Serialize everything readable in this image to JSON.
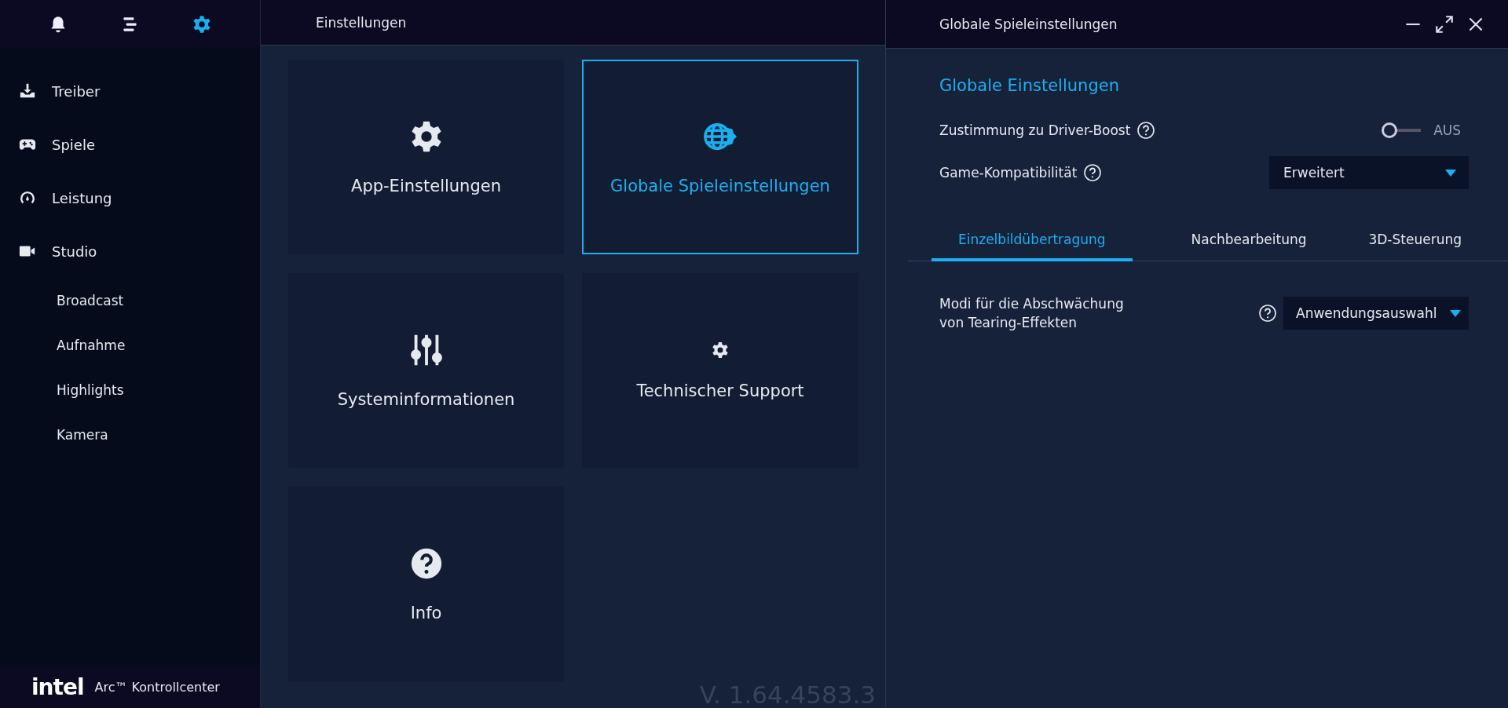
{
  "sidebar": {
    "top_icons": [
      {
        "kind": "bell",
        "selected": false
      },
      {
        "kind": "menu",
        "selected": false
      },
      {
        "kind": "gear",
        "selected": true
      }
    ],
    "items": [
      {
        "label": "Treiber",
        "kind": "download"
      },
      {
        "label": "Spiele",
        "kind": "gamepad"
      },
      {
        "label": "Leistung",
        "kind": "gauge"
      },
      {
        "label": "Studio",
        "kind": "camera",
        "children": [
          {
            "label": "Broadcast"
          },
          {
            "label": "Aufnahme"
          },
          {
            "label": "Highlights"
          },
          {
            "label": "Kamera"
          }
        ]
      }
    ],
    "footer": {
      "logo": "intel",
      "product": "Arc™ Kontrollcenter"
    }
  },
  "settings": {
    "title": "Einstellungen",
    "cards": [
      {
        "label": "App-Einstellungen",
        "kind": "gear",
        "selected": false
      },
      {
        "label": "Globale Spieleinstellungen",
        "kind": "globe-gear",
        "selected": true
      },
      {
        "label": "Systeminformationen",
        "kind": "sliders",
        "selected": false
      },
      {
        "label": "Technischer Support",
        "kind": "small-gear",
        "selected": false
      },
      {
        "label": "Info",
        "kind": "help",
        "selected": false
      }
    ],
    "version": "V. 1.64.4583.3"
  },
  "detail": {
    "title": "Globale Spieleinstellungen",
    "heading": "Globale Einstellungen",
    "rows": [
      {
        "label": "Zustimmung zu Driver-Boost",
        "kind": "toggle",
        "on": false,
        "value": "AUS"
      },
      {
        "label": "Game-Kompatibilität",
        "kind": "dropdown",
        "value": "Erweitert"
      }
    ],
    "tabs": [
      {
        "label": "Einzelbildübertragung",
        "selected": true
      },
      {
        "label": "Nachbearbeitung",
        "selected": false
      },
      {
        "label": "3D-Steuerung",
        "selected": false
      }
    ],
    "options": [
      {
        "label": "Modi für die Abschwächung\nvon Tearing-Effekten",
        "value": "Anwendungsauswahl"
      }
    ]
  }
}
